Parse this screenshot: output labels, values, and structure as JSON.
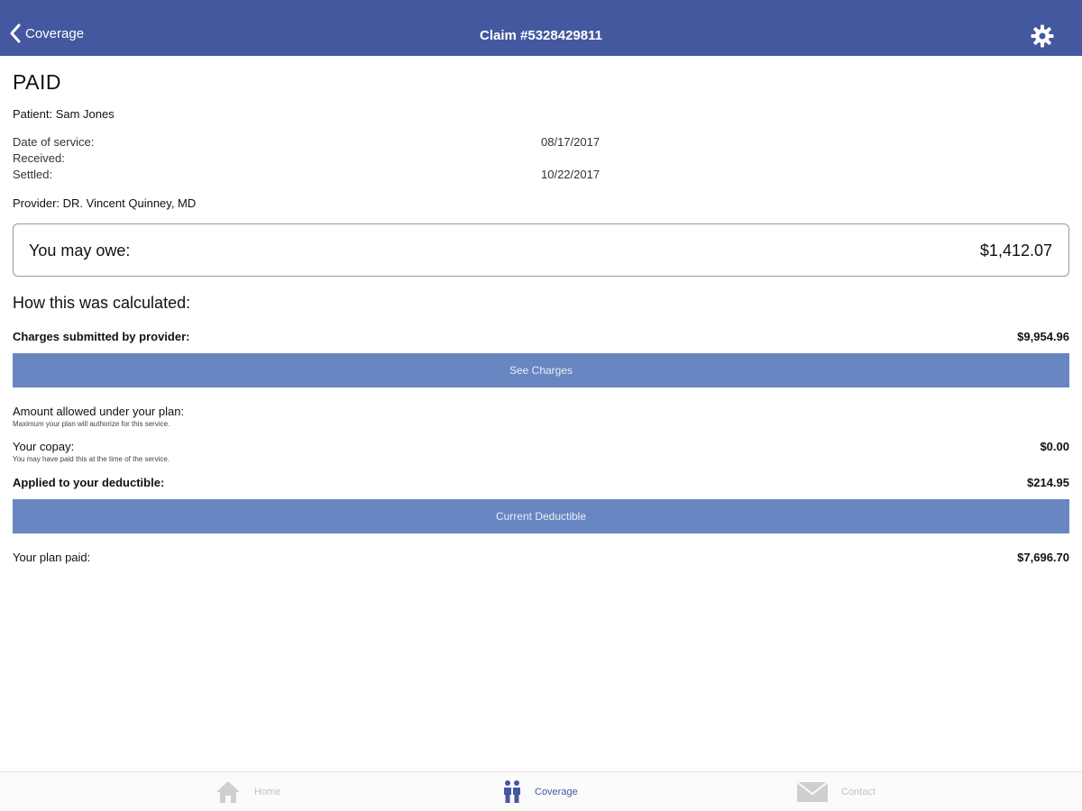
{
  "nav": {
    "back_label": "Coverage",
    "title": "Claim #5328429811"
  },
  "claim": {
    "status": "PAID",
    "patient": "Patient: Sam Jones",
    "dates": [
      {
        "label": "Date of service:",
        "value": "08/17/2017"
      },
      {
        "label": "Received:",
        "value": ""
      },
      {
        "label": "Settled:",
        "value": "10/22/2017"
      }
    ],
    "provider": "Provider: DR. Vincent Quinney, MD"
  },
  "owe": {
    "label": "You may owe:",
    "value": "$1,412.07"
  },
  "calculation": {
    "heading": "How this was calculated:",
    "charges": {
      "label": "Charges submitted by provider:",
      "value": "$9,954.96"
    },
    "see_charges_button": "See Charges",
    "allowed": {
      "label": "Amount allowed under your plan:",
      "sub": "Maximum your plan will authorize for this service.",
      "value": ""
    },
    "copay": {
      "label": "Your copay:",
      "sub": "You may have paid this at the time of the service.",
      "value": "$0.00"
    },
    "deductible": {
      "label": "Applied to your deductible:",
      "value": "$214.95"
    },
    "current_deductible_button": "Current Deductible",
    "plan_paid": {
      "label": "Your plan paid:",
      "value": "$7,696.70"
    }
  },
  "tabbar": {
    "tabs": [
      {
        "label": "Home",
        "icon": "home-icon",
        "active": false
      },
      {
        "label": "Coverage",
        "icon": "people-icon",
        "active": true
      },
      {
        "label": "Contact",
        "icon": "envelope-icon",
        "active": false
      }
    ]
  },
  "colors": {
    "navbar": "#44589f",
    "button": "#6886c1",
    "active_tab": "#44589f",
    "inactive_tab": "#c4c4c4"
  }
}
